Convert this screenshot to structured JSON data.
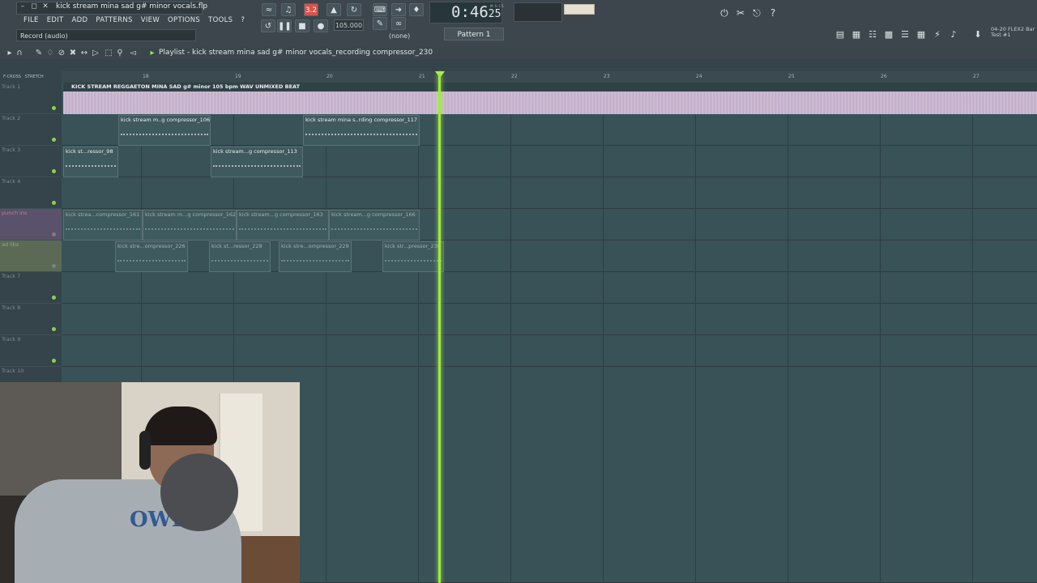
{
  "window": {
    "file_title": "kick stream mina sad g# minor vocals.flp"
  },
  "menu": [
    "FILE",
    "EDIT",
    "ADD",
    "PATTERNS",
    "VIEW",
    "OPTIONS",
    "TOOLS",
    "?"
  ],
  "hint": "Record (audio)",
  "transport": {
    "tempo": "105.000",
    "time": "0:46",
    "time_sub": "25",
    "time_units": "M:S:CS",
    "pattern": "Pattern 1",
    "none_label": "(none)",
    "active_snap": "3.2"
  },
  "right_info": {
    "line1": "04-20 FLEX2 Bar",
    "line2": "Test #1"
  },
  "playlist": {
    "title": "Playlist - kick stream mina sad g# minor vocals_recording compressor_230"
  },
  "ruler": {
    "ticks": [
      "18",
      "19",
      "20",
      "21",
      "22",
      "23",
      "24",
      "25",
      "26",
      "27"
    ],
    "labels": [
      "F-CROSS",
      "STRETCH"
    ]
  },
  "tracks": [
    {
      "name": "Track 1"
    },
    {
      "name": "Track 2"
    },
    {
      "name": "Track 3"
    },
    {
      "name": "Track 4"
    },
    {
      "name": "punch ins"
    },
    {
      "name": "ad libs"
    },
    {
      "name": "Track 7"
    },
    {
      "name": "Track 8"
    },
    {
      "name": "Track 9"
    },
    {
      "name": "Track 10"
    }
  ],
  "clips": {
    "beat": "KICK STREAM REGGAETON MINA SAD g# minor 105 bpm WAV UNMIXED BEAT",
    "t2a": "kick stream m..g compressor_106",
    "t2b": "kick stream mina s..rding compressor_117",
    "t3a": "kick st...ressor_98",
    "t3b": "kick stream...g compressor_113",
    "p1": "kick strea...compressor_161",
    "p2": "kick stream m...g compressor_162",
    "p3": "kick stream...g compressor_163",
    "p4": "kick stream...g compressor_166",
    "a1": "kick stre...ompressor_226",
    "a2": "kick st...ressor_228",
    "a3": "kick stre...ompressor_229",
    "a4": "kick str...pressor_230"
  },
  "webcam": {
    "shirt_text": "OWL"
  }
}
